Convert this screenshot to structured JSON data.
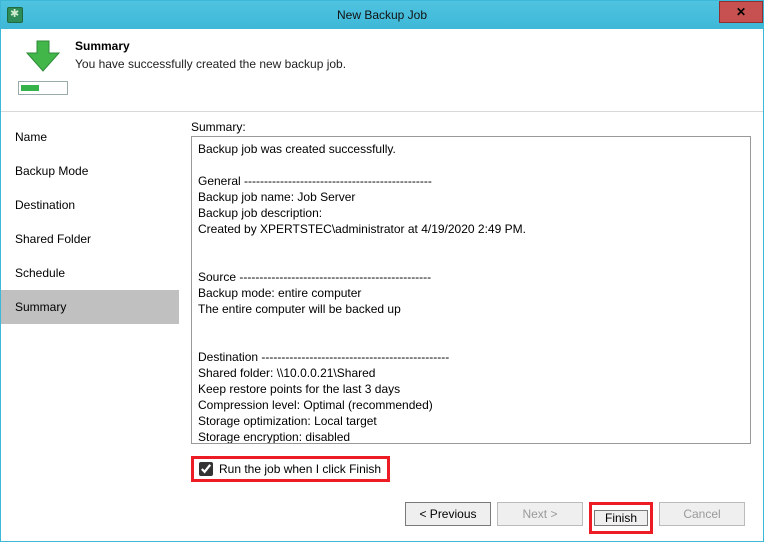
{
  "window": {
    "title": "New Backup Job",
    "close_glyph": "✕"
  },
  "header": {
    "title": "Summary",
    "subtitle": "You have successfully created the new backup job."
  },
  "sidebar": {
    "items": [
      {
        "label": "Name",
        "selected": false
      },
      {
        "label": "Backup Mode",
        "selected": false
      },
      {
        "label": "Destination",
        "selected": false
      },
      {
        "label": "Shared Folder",
        "selected": false
      },
      {
        "label": "Schedule",
        "selected": false
      },
      {
        "label": "Summary",
        "selected": true
      }
    ]
  },
  "main": {
    "summary_label": "Summary:",
    "summary_text": "Backup job was created successfully.\n\nGeneral -----------------------------------------------\nBackup job name: Job Server\nBackup job description:\nCreated by XPERTSTEC\\administrator at 4/19/2020 2:49 PM.\n\n\nSource ------------------------------------------------\nBackup mode: entire computer\nThe entire computer will be backed up\n\n\nDestination -----------------------------------------------\nShared folder: \\\\10.0.0.21\\Shared\nKeep restore points for the last 3 days\nCompression level: Optimal (recommended)\nStorage optimization: Local target\nStorage encryption: disabled"
  },
  "run_checkbox": {
    "label": "Run the job when I click Finish",
    "checked": true
  },
  "footer": {
    "previous": "< Previous",
    "next": "Next >",
    "finish": "Finish",
    "cancel": "Cancel"
  }
}
